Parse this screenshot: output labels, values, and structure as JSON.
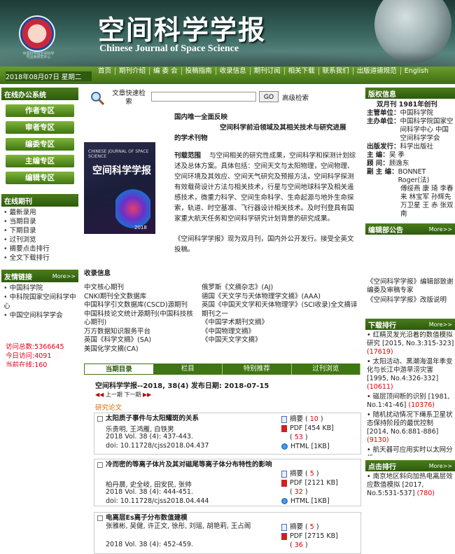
{
  "header": {
    "title_cn": "空间科学学报",
    "title_en": "Chinese Journal of Space Science",
    "logo_caption": "中国科学院空间科学与应用研究中心"
  },
  "nav": {
    "date": "2018年08月07日 星期二",
    "items": [
      "首页",
      "期刊介绍",
      "编 委 会",
      "投稿指南",
      "收录信息",
      "期刊订阅",
      "相关下载",
      "联系我们",
      "出版道德规范",
      "English"
    ]
  },
  "left": {
    "online_office_title": "在线办公系统",
    "zone_buttons": [
      "作者专区",
      "审者专区",
      "编委专区",
      "主编专区",
      "编辑专区"
    ],
    "online_journal_title": "在线期刊",
    "journal_links": [
      "最新录用",
      "当期目录",
      "下期目录",
      "过刊浏览",
      "摘要点击排行",
      "全文下载排行"
    ],
    "friend_links_title": "友情链接",
    "more": "More>>",
    "friend_links": [
      "中国科学院",
      "中科院国家空间科学中心",
      "中国空间科学学会"
    ],
    "stats": [
      "访问总数:5366645",
      "今日访问:4091",
      "当前在线:160"
    ]
  },
  "search": {
    "label": "文章快速检索",
    "placeholder": "",
    "go": "GO",
    "advanced": "高级检索"
  },
  "intro": {
    "line1": "国内唯一全面反映",
    "line2": "空间科学前沿领域及其相关技术与研究进展",
    "line3": "的学术刊物",
    "scope_label": "刊载范围",
    "scope_text": "与空间相关的研究性成果，空间科学和探测计划综述及总体方案。具体包括：空间天文与太阳物理，空间物理、空间环境及其效应、空间天气研究及预报方法，空间科学探测有效载荷设计方法与相关技术，行星与空间地球科学及相关遥感技术，微重力科学、空间生命科学、生命起源与地外生命探索，轨道、时空基准、飞行器设计相关技术。及时刊登具有国家重大航天任务和空间科学研究计划背景的研究成果。",
    "announce": "《空间科学学报》现为双月刊，国内外公开发行。接受全英文投稿。"
  },
  "cover": {
    "title_en": "CHINESE JOURNAL OF SPACE SCIENCE",
    "title_cn": "空间科学学报",
    "year": "2018"
  },
  "indexing": {
    "title": "收录信息",
    "col1": [
      "中文核心期刊",
      "CNKI期刊全文数据库",
      "中国科学引文数据库(CSCD)源期刊",
      "中国科技论文统计源期刊(中国科技核心期刊)",
      "万方数据知识服务平台",
      "英国《科学文摘》(SA)",
      "美国化学文摘(CA)"
    ],
    "col2": [
      "俄罗斯《文摘杂志》(AJ)",
      "德国《天文学与天体物理学文摘》(AAA)",
      "英国《中国天文学和天体物理学》(SCI收录)全文摘译期刊之一",
      "《中国学术期刊文摘》",
      "《中国物理文摘》",
      "《中国天文学文摘》"
    ]
  },
  "tabs": [
    "当期目录",
    "栏目",
    "特别推荐",
    "过刊浏览"
  ],
  "issue": {
    "info": "空间科学学报--2018, 38(4)  发布日期: 2018-07-15",
    "prev": "上一期",
    "next": "下一期",
    "section": "研究论文"
  },
  "articles": [
    {
      "title": "太阳质子事件与太阳耀斑的关系",
      "authors": "乐贵明, 王鸿雁, 白铁男",
      "ref": "2018 Vol. 38 (4): 437-443.",
      "doi": "doi: 10.11728/cjss2018.04.437",
      "abstract": "摘要",
      "abstract_count": "10",
      "pdf": "PDF [454 KB]",
      "pdf_count": "53",
      "html": "HTML [1KB]"
    },
    {
      "title": "冷而密的等离子体片及其对磁尾等离子体分布特性的影响",
      "authors": "柏丹晨, 史全岐, 田安民, 张帅",
      "ref": "2018 Vol. 38 (4): 444-451.",
      "doi": "doi: 10.11728/cjss2018.04.444",
      "abstract": "摘要",
      "abstract_count": "5",
      "pdf": "PDF [2121 KB]",
      "pdf_count": "32",
      "html": "HTML [1KB]"
    },
    {
      "title": "电离层Es离子分布数值建模",
      "authors": "张雅彬, 吴健, 许正文, 徐彤, 刘瑶, 胡艳莉, 王占阁",
      "ref": "2018 Vol. 38 (4): 452-459.",
      "doi": "",
      "abstract": "摘要",
      "abstract_count": "5",
      "pdf": "PDF [2715 KB]",
      "pdf_count": "36",
      "html": ""
    }
  ],
  "right": {
    "info_title": "版权信息",
    "freq": "双月刊  1981年创刊",
    "rows": [
      {
        "k": "主管单位：",
        "v": "中国科学院"
      },
      {
        "k": "主办单位：",
        "v": "中国科学院国家空间科学中心 中国空间科学学会"
      },
      {
        "k": "出版发行：",
        "v": "科学出版社"
      },
      {
        "k": "主    编：",
        "v": "吴 季"
      },
      {
        "k": "顾    问：",
        "v": "顾逸东"
      },
      {
        "k": "副 主 编：",
        "v": "BONNET Roger(法)"
      }
    ],
    "deputies": "傅绥燕  康 琦 李春来  林宝军 孙辉先  万卫星 王 赤  张双南",
    "notice_title": "编辑部公告",
    "notices": [
      "《空间科学学报》编辑部致谢编委及审稿专家",
      "《空间科学学报》改版说明"
    ],
    "download_title": "下载排行",
    "downloads": [
      {
        "text": "红精灵发光沿着的数值模拟研究 [2015, No.3:315-323]",
        "count": "(17619)"
      },
      {
        "text": "太阳活动、黑潮海温年季变化与长江中游旱涝灾害 [1995, No.4:326-332]",
        "count": "(10611)"
      },
      {
        "text": "磁层顶间断的识别 [1981, No.1:41-46]",
        "count": "(10376)"
      },
      {
        "text": "随机扰动情况下绳系卫星状态保持阶段的最优控制 [2014, No.6:881-886]",
        "count": "(9130)"
      },
      {
        "text": "航天器可应用实时以太网分析",
        "count": ""
      }
    ],
    "clicks_title": "点击排行",
    "clicks": [
      {
        "text": "南京地区斜向加热电离层效应数值模拟 [2017, No.5:531-537]",
        "count": "(780)"
      }
    ]
  }
}
